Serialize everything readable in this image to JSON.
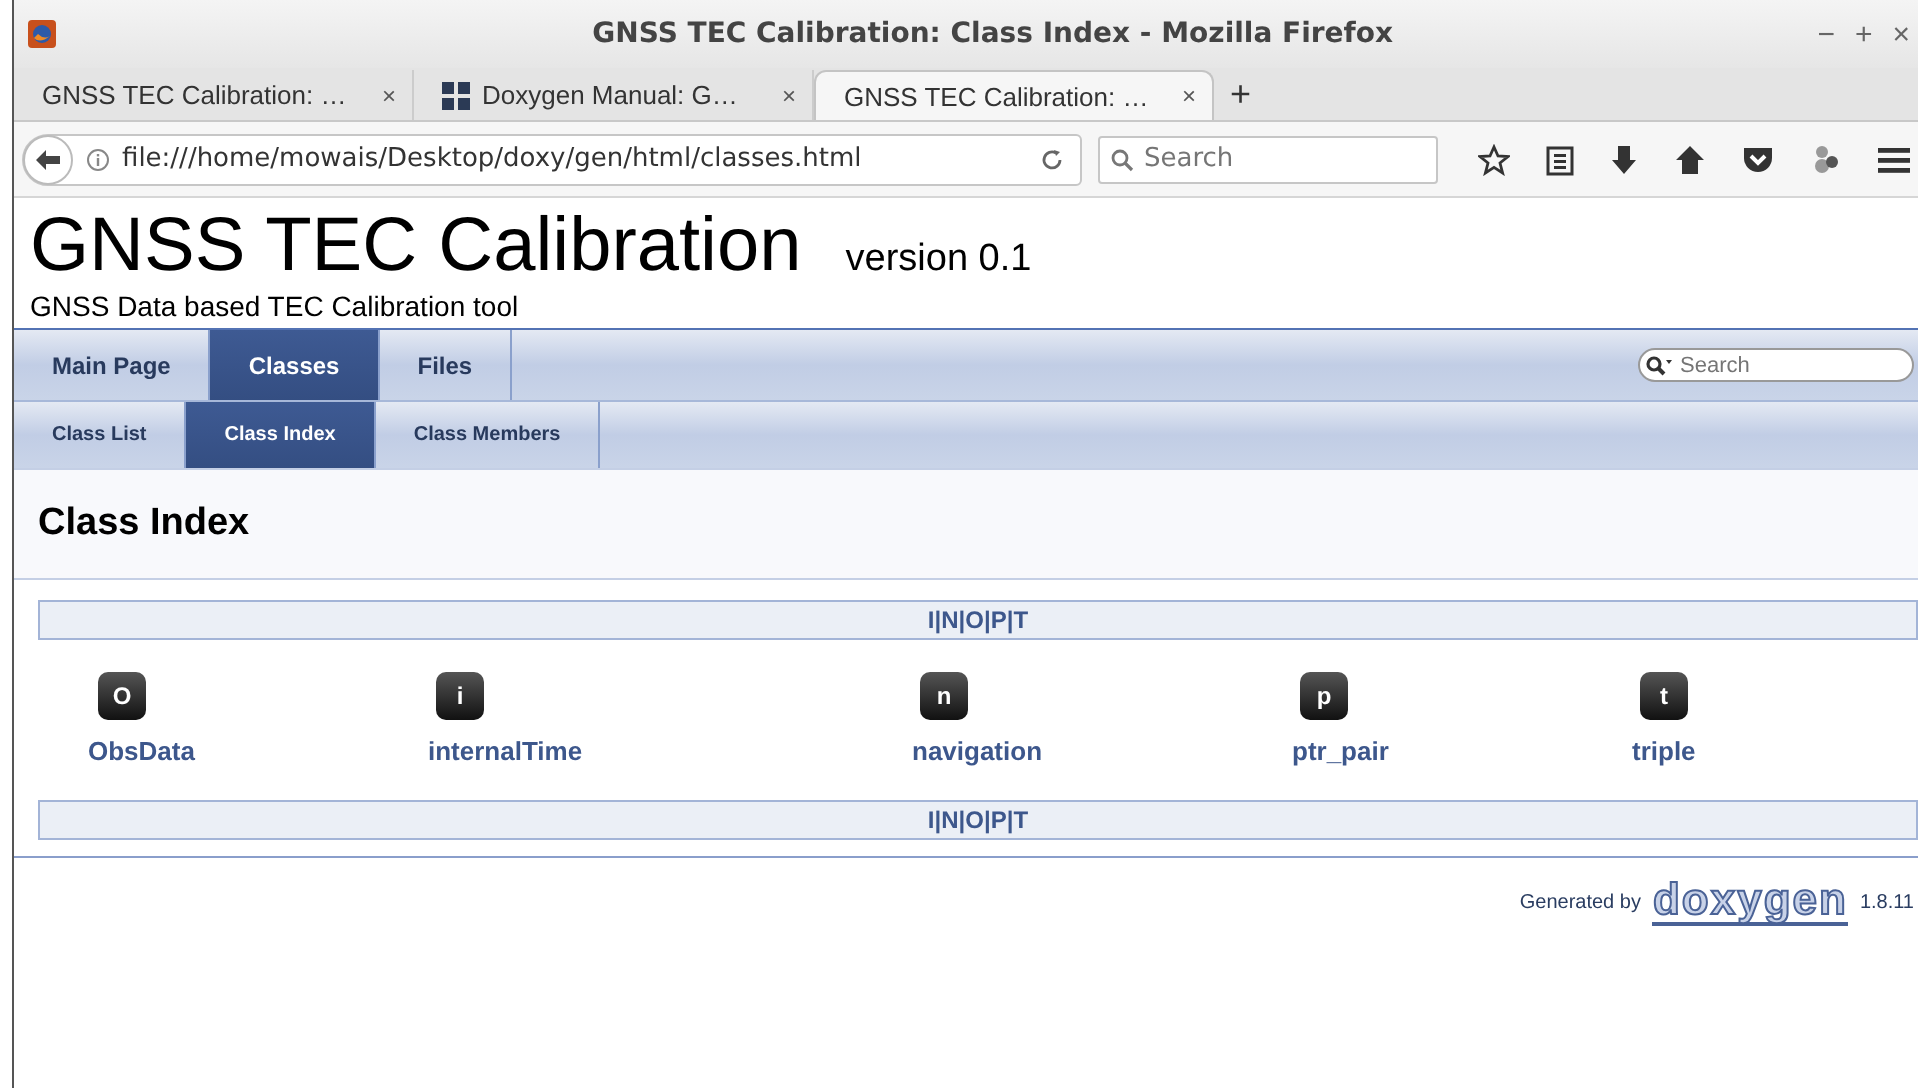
{
  "window": {
    "title": "GNSS TEC Calibration: Class Index - Mozilla Firefox",
    "controls": [
      "−",
      "+",
      "×"
    ]
  },
  "tabs": [
    {
      "label": "GNSS TEC Calibration: …",
      "selected": false
    },
    {
      "label": "Doxygen Manual: G…",
      "selected": false
    },
    {
      "label": "GNSS TEC Calibration: …",
      "selected": true
    }
  ],
  "new_tab": "+",
  "tab_close": "×",
  "url": "file:///home/mowais/Desktop/doxy/gen/html/classes.html",
  "browser_search": {
    "placeholder": "Search"
  },
  "project": {
    "name": "GNSS TEC Calibration",
    "version": "version 0.1",
    "brief": "GNSS Data based TEC Calibration tool"
  },
  "nav": [
    {
      "label": "Main Page",
      "selected": false
    },
    {
      "label": "Classes",
      "selected": true
    },
    {
      "label": "Files",
      "selected": false
    }
  ],
  "doc_search": {
    "placeholder": "Search"
  },
  "subnav": [
    {
      "label": "Class List",
      "selected": false
    },
    {
      "label": "Class Index",
      "selected": true
    },
    {
      "label": "Class Members",
      "selected": false
    }
  ],
  "heading": "Class Index",
  "index_top": {
    "letters": [
      "I",
      "N",
      "O",
      "P",
      "T"
    ],
    "separators": [
      "|",
      "|",
      "|",
      "|"
    ]
  },
  "classes": [
    {
      "letter": "O",
      "name": "ObsData"
    },
    {
      "letter": "i",
      "name": "internalTime"
    },
    {
      "letter": "n",
      "name": "navigation"
    },
    {
      "letter": "p",
      "name": "ptr_pair"
    },
    {
      "letter": "t",
      "name": "triple"
    }
  ],
  "index_bottom": {
    "letters": [
      "I",
      "N",
      "O",
      "P",
      "T"
    ],
    "separators": [
      "|",
      "|",
      "|",
      "|"
    ]
  },
  "footer": {
    "generated": "Generated by",
    "logo": "doxygen",
    "version": "1.8.11"
  }
}
